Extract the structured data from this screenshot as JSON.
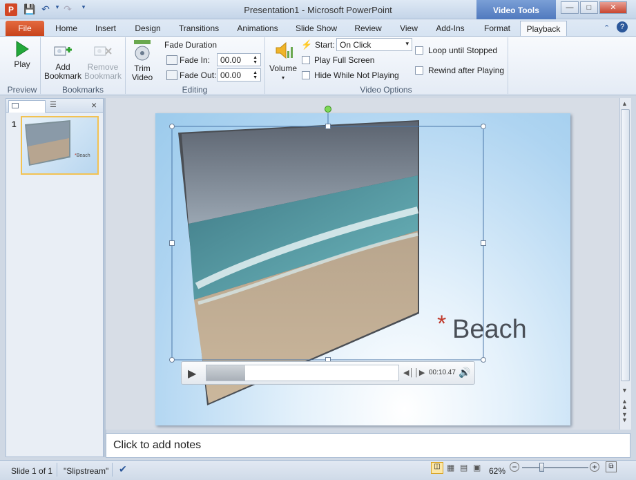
{
  "window": {
    "title": "Presentation1 - Microsoft PowerPoint",
    "contextual_tab_group": "Video Tools",
    "buttons": [
      "minimize",
      "maximize",
      "close"
    ]
  },
  "quick_access": {
    "app_icon": "P",
    "items": [
      "save-icon",
      "undo-icon",
      "redo-icon",
      "customize-icon"
    ]
  },
  "tabs": [
    {
      "label": "File"
    },
    {
      "label": "Home"
    },
    {
      "label": "Insert"
    },
    {
      "label": "Design"
    },
    {
      "label": "Transitions"
    },
    {
      "label": "Animations"
    },
    {
      "label": "Slide Show"
    },
    {
      "label": "Review"
    },
    {
      "label": "View"
    },
    {
      "label": "Add-Ins"
    },
    {
      "label": "Format"
    },
    {
      "label": "Playback"
    }
  ],
  "ribbon": {
    "preview": {
      "group_label": "Preview",
      "play_label": "Play"
    },
    "bookmarks": {
      "group_label": "Bookmarks",
      "add_label_1": "Add",
      "add_label_2": "Bookmark",
      "remove_label_1": "Remove",
      "remove_label_2": "Bookmark"
    },
    "editing": {
      "group_label": "Editing",
      "trim_label_1": "Trim",
      "trim_label_2": "Video",
      "fade_duration": "Fade Duration",
      "fade_in_label": "Fade In:",
      "fade_in_value": "00.00",
      "fade_out_label": "Fade Out:",
      "fade_out_value": "00.00"
    },
    "video_options": {
      "group_label": "Video Options",
      "volume_label": "Volume",
      "start_label": "Start:",
      "start_value": "On Click",
      "play_full_screen": "Play Full Screen",
      "hide_while_not_playing": "Hide While Not Playing",
      "loop_until_stopped": "Loop until Stopped",
      "rewind_after_playing": "Rewind after Playing"
    }
  },
  "slides_pane": {
    "slide_number": "1",
    "thumb_title": "Beach"
  },
  "slide": {
    "title_mark": "*",
    "title": "Beach",
    "video_controls": {
      "time": "00:10.47",
      "progress": 0.2
    }
  },
  "notes": {
    "placeholder": "Click to add notes"
  },
  "status": {
    "slide": "Slide 1 of 1",
    "theme": "\"Slipstream\"",
    "zoom": "62%"
  },
  "colors": {
    "accent": "#2b579a",
    "file_tab": "#c8441c",
    "title_mark": "#c0392b"
  }
}
